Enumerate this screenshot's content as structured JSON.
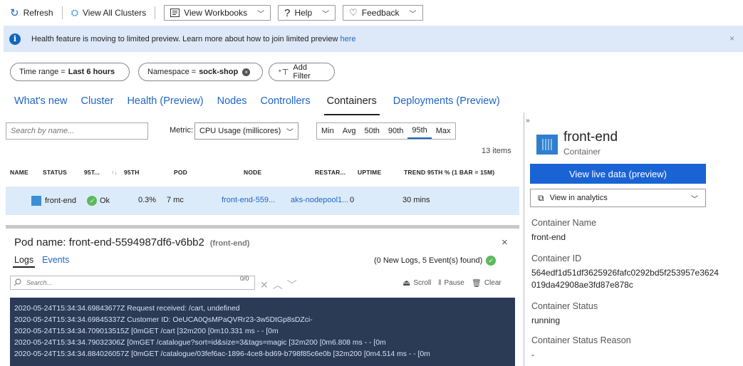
{
  "toolbar": {
    "refresh": "Refresh",
    "view_all_clusters": "View All Clusters",
    "view_workbooks": "View Workbooks",
    "help": "Help",
    "feedback": "Feedback"
  },
  "banner": {
    "text": "Health feature is moving to limited preview. Learn more about how to join limited preview",
    "link": "here",
    "close": "×"
  },
  "filters": {
    "time_range_label": "Time range =",
    "time_range_value": "Last 6 hours",
    "namespace_label": "Namespace =",
    "namespace_value": "sock-shop",
    "add_filter": "Add Filter"
  },
  "tabs": [
    "What's new",
    "Cluster",
    "Health (Preview)",
    "Nodes",
    "Controllers",
    "Containers",
    "Deployments (Preview)"
  ],
  "active_tab": "Containers",
  "grid": {
    "search_placeholder": "Search by name...",
    "metric_label": "Metric:",
    "metric_value": "CPU Usage (millicores)",
    "percentiles": [
      "Min",
      "Avg",
      "50th",
      "90th",
      "95th",
      "Max"
    ],
    "active_percentile": "95th",
    "items_count": "13 items",
    "headers": {
      "name": "NAME",
      "status": "STATUS",
      "p95pct": "95T...",
      "sort": "↑↓",
      "p95": "95TH",
      "pod": "POD",
      "node": "NODE",
      "restarts": "RESTAR...",
      "uptime": "UPTIME",
      "trend": "TREND 95TH % (1 BAR = 15M)"
    },
    "row": {
      "name": "front-end",
      "status": "Ok",
      "p95pct": "0.3%",
      "p95": "7 mc",
      "pod": "front-end-559...",
      "node": "aks-nodepool1...",
      "restarts": "0",
      "uptime": "30 mins"
    }
  },
  "pod": {
    "title": "Pod name: front-end-5594987df6-v6bb2",
    "subtitle": "(front-end)",
    "close": "×",
    "tabs": [
      "Logs",
      "Events"
    ],
    "log_count": "(0 New Logs, 5 Event(s) found)",
    "search_placeholder": "Search...",
    "search_count": "0/0",
    "scroll": "Scroll",
    "pause": "Pause",
    "clear": "Clear",
    "lines": [
      "2020-05-24T15:34:34.69843677Z Request received: /cart, undefined",
      "2020-05-24T15:34:34.69845337Z Customer ID: OeUCA0QsMPaQVRr23-3w5DtGp8sDZci-",
      "2020-05-24T15:34:34.709013515Z  [0mGET /cart  [32m200  [0m10.331 ms - -  [0m",
      "2020-05-24T15:34:34.79032306Z  [0mGET /catalogue?sort=id&size=3&tags=magic  [32m200  [0m6.808 ms - -  [0m",
      "2020-05-24T15:34:34.884026057Z  [0mGET /catalogue/03fef6ac-1896-4ce8-bd69-b798f85c6e0b  [32m200  [0m4.514 ms - -  [0m"
    ]
  },
  "panel": {
    "title": "front-end",
    "type": "Container",
    "live_button": "View live data (preview)",
    "analytics": "View in analytics",
    "container_name_label": "Container Name",
    "container_name": "front-end",
    "container_id_label": "Container ID",
    "container_id_1": "564edf1d51df3625926fafc0292bd5f253957e3624",
    "container_id_2": "019da42908ae3fd87e878c",
    "status_label": "Container Status",
    "status": "running",
    "status_reason_label": "Container Status Reason",
    "status_reason": "-"
  },
  "colors": {
    "accent": "#1a63d5",
    "banner": "#dde9f8",
    "row_selected": "#dcebf9",
    "console_bg": "#2b3a55",
    "ok": "#5cb85c"
  }
}
